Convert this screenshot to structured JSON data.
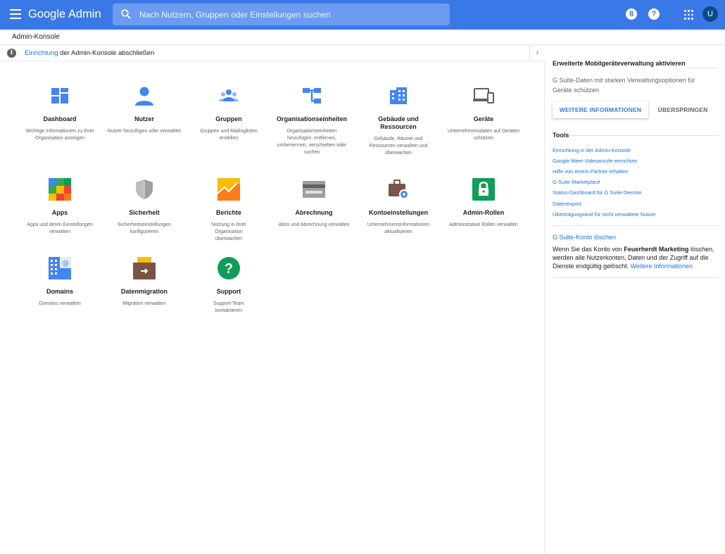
{
  "app": {
    "brand": "Google Admin"
  },
  "search": {
    "placeholder": "Nach Nutzern, Gruppen oder Einstellungen suchen"
  },
  "topbar": {
    "notifications_count": "8",
    "help_label": "?",
    "avatar_letter": "U"
  },
  "breadcrumb": "Admin-Konsole",
  "notice": {
    "link": "Einrichtung",
    "text": " der Admin-Konsole abschließen"
  },
  "cards": [
    {
      "title": "Dashboard",
      "desc": "Wichtige Informationen zu Ihrer Organisation anzeigen",
      "icon": "dashboard-icon"
    },
    {
      "title": "Nutzer",
      "desc": "Nutzer hinzufügen oder verwalten",
      "icon": "user-icon"
    },
    {
      "title": "Gruppen",
      "desc": "Gruppen und Mailinglisten erstellen",
      "icon": "groups-icon"
    },
    {
      "title": "Organisationseinheiten",
      "desc": "Organisationseinheiten hinzufügen, entfernen, umbenennen, verschieben oder suchen",
      "icon": "org-units-icon"
    },
    {
      "title": "Gebäude und Ressourcen",
      "desc": "Gebäude, Räume und Ressourcen verwalten und überwachen",
      "icon": "building-icon"
    },
    {
      "title": "Geräte",
      "desc": "Unternehmensdaten auf Geräten schützen",
      "icon": "devices-icon"
    },
    {
      "title": "Apps",
      "desc": "Apps und deren Einstellungen verwalten",
      "icon": "apps-icon"
    },
    {
      "title": "Sicherheit",
      "desc": "Sicherheitseinstellungen konfigurieren",
      "icon": "shield-icon"
    },
    {
      "title": "Berichte",
      "desc": "Nutzung in Ihrer Organisation überwachen",
      "icon": "reports-icon"
    },
    {
      "title": "Abrechnung",
      "desc": "Abos und Abrechnung verwalten",
      "icon": "billing-card-icon"
    },
    {
      "title": "Kontoeinstellungen",
      "desc": "Unternehmensinformationen aktualisieren",
      "icon": "briefcase-gear-icon"
    },
    {
      "title": "Admin-Rollen",
      "desc": "Administrative Rollen verwalten",
      "icon": "lock-icon"
    },
    {
      "title": "Domains",
      "desc": "Domains verwalten",
      "icon": "domains-icon"
    },
    {
      "title": "Datenmigration",
      "desc": "Migration verwalten",
      "icon": "migration-box-icon"
    },
    {
      "title": "Support",
      "desc": "Support-Team kontaktieren",
      "icon": "help-circle-icon"
    }
  ],
  "right": {
    "promo_title": "Erweiterte Mobilgeräteverwaltung aktivieren",
    "promo_text": "G Suite-Daten mit starken Verwaltungsoptionen für Geräte schützen",
    "learn_more_button": "WEITERE INFORMATIONEN",
    "skip_button": "ÜBERSPRINGEN",
    "tools_title": "Tools",
    "tools": [
      "Einrichtung in der Admin-Konsole",
      "Google Meet-Videoanrufe einrichten",
      "Hilfe von einem Partner erhalten",
      "G Suite Marketplace",
      "Status-Dashboard für G Suite-Dienste",
      "Datenexport",
      "Übertragungstool für nicht verwaltete Nutzer"
    ],
    "delete_title": "G Suite-Konto löschen",
    "delete_text_1": "Wenn Sie das Konto von ",
    "delete_company": "Feuerherdt Marketing",
    "delete_text_2": " löschen, werden alle Nutzerkonten, Daten und der Zugriff auf die Dienste endgültig gelöscht. ",
    "delete_link": "Weitere Informationen"
  },
  "colors": {
    "topbar": "#3b78e7",
    "link": "#1a73e8",
    "icon_blue": "#4285f4"
  }
}
